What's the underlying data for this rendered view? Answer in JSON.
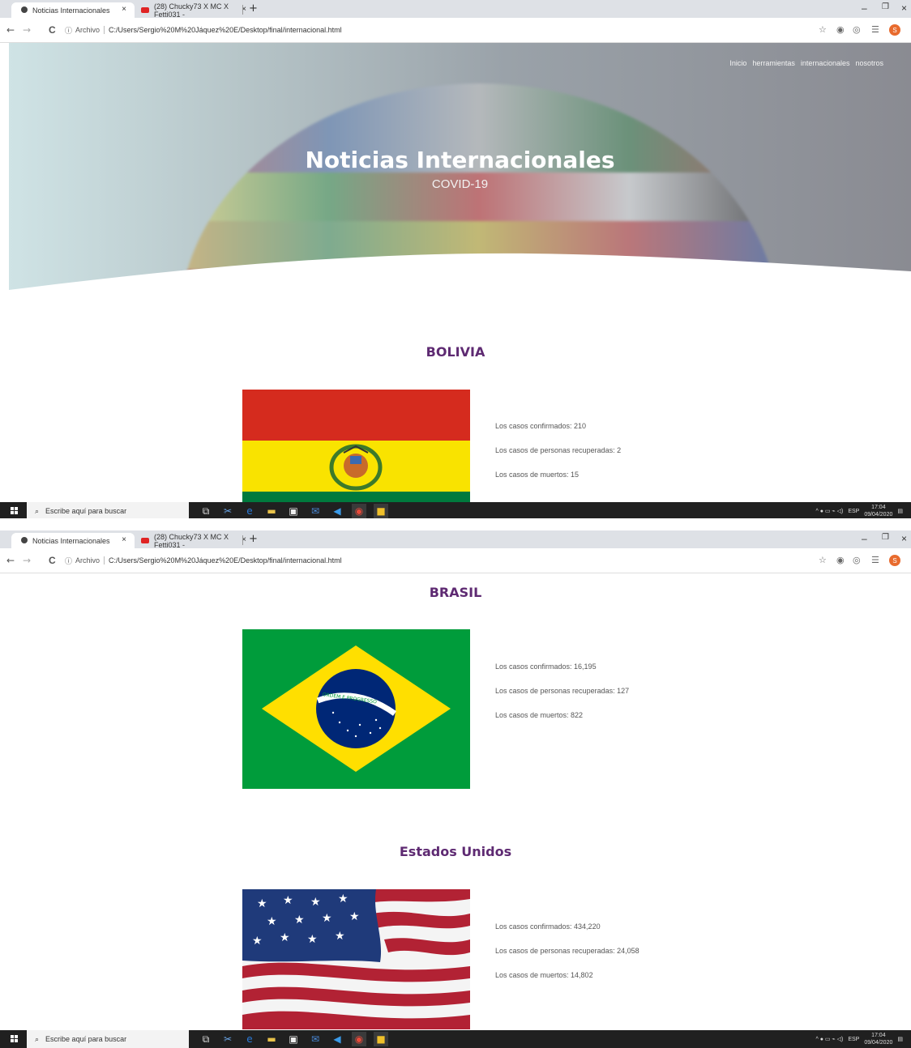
{
  "browser": {
    "tabs": [
      {
        "label": "Noticias Internacionales"
      },
      {
        "label": "(28) Chucky73 X MC X Fetti031 -"
      }
    ],
    "tab_close": "×",
    "new_tab": "+",
    "window_controls": {
      "minimize": "–",
      "maximize": "❐",
      "close": "×"
    },
    "nav": {
      "back": "←",
      "forward": "→",
      "reload": "C"
    },
    "info_icon": "ⓘ",
    "scheme_label": "Archivo",
    "url": "C:/Users/Sergio%20M%20Jáquez%20E/Desktop/final/internacional.html",
    "avatar_letter": "S"
  },
  "hero": {
    "nav": [
      "Inicio",
      "herramientas",
      "internacionales",
      "nosotros"
    ],
    "title": "Noticias Internacionales",
    "subtitle": "COVID-19"
  },
  "countries": [
    {
      "name": "BOLIVIA",
      "confirmed": "Los casos confirmados: 210",
      "recovered": "Los casos de personas recuperadas: 2",
      "deaths": "Los casos de muertos: 15"
    },
    {
      "name": "BRASIL",
      "flag_text": "ORDEM E PROGRESSO",
      "confirmed": "Los casos confirmados: 16,195",
      "recovered": "Los casos de personas recuperadas: 127",
      "deaths": "Los casos de muertos: 822"
    },
    {
      "name": "Estados Unidos",
      "confirmed": "Los casos confirmados: 434,220",
      "recovered": "Los casos de personas recuperadas: 24,058",
      "deaths": "Los casos de muertos: 14,802"
    }
  ],
  "taskbar": {
    "search_placeholder": "Escribe aquí para buscar",
    "language": "ESP",
    "time": "17:04",
    "date": "09/04/2020"
  }
}
